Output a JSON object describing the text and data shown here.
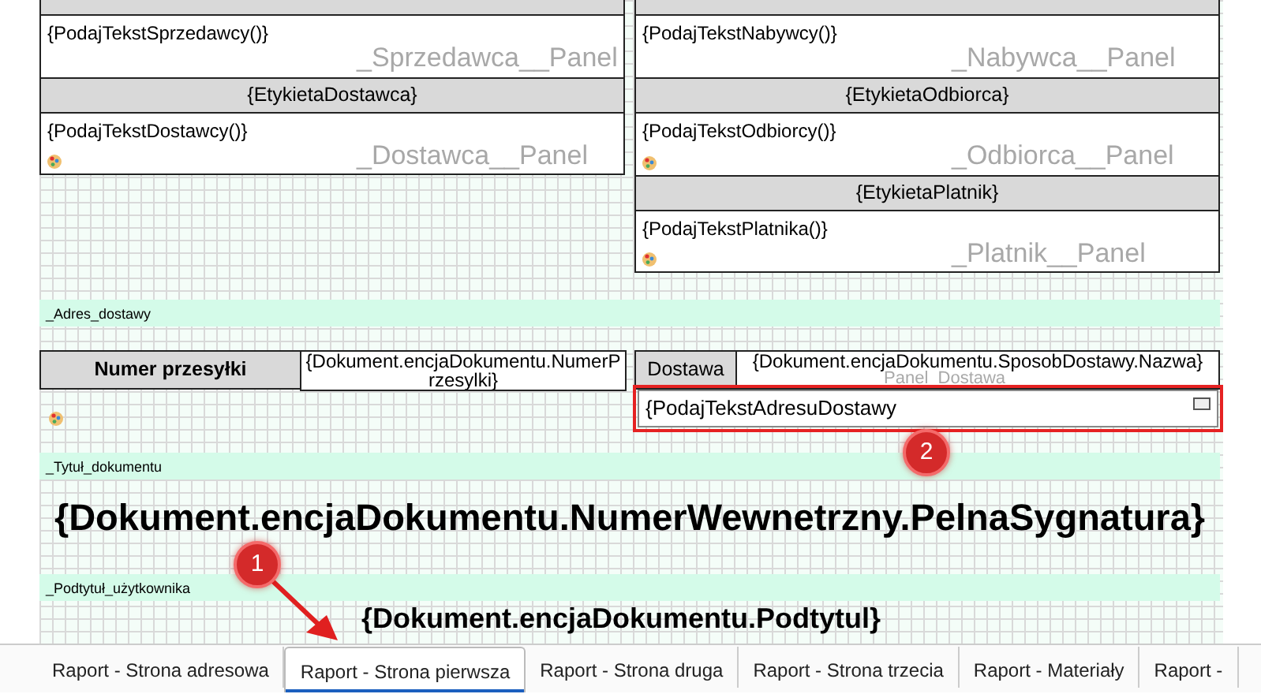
{
  "left_column": [
    {
      "kind": "header"
    },
    {
      "kind": "body",
      "text": "{PodajTekstSprzedawcy()}",
      "ghost": "_Sprzedawca__Panel",
      "has_icon": false
    },
    {
      "kind": "header",
      "text": "{EtykietaDostawca}"
    },
    {
      "kind": "body",
      "text": "{PodajTekstDostawcy()}",
      "ghost": "_Dostawca__Panel",
      "has_icon": true
    }
  ],
  "right_column": [
    {
      "kind": "header"
    },
    {
      "kind": "body",
      "text": "{PodajTekstNabywcy()}",
      "ghost": "_Nabywca__Panel",
      "has_icon": false
    },
    {
      "kind": "header",
      "text": "{EtykietaOdbiorca}"
    },
    {
      "kind": "body",
      "text": "{PodajTekstOdbiorcy()}",
      "ghost": "_Odbiorca__Panel",
      "has_icon": true
    },
    {
      "kind": "header",
      "text": "{EtykietaPlatnik}"
    },
    {
      "kind": "body",
      "text": "{PodajTekstPlatnika()}",
      "ghost": "_Platnik__Panel",
      "has_icon": true
    }
  ],
  "bands": [
    {
      "label": "_Adres_dostawy"
    },
    {
      "label": "_Tytuł_dokumentu"
    },
    {
      "label": "_Podtytuł_użytkownika"
    }
  ],
  "shipment": {
    "label": "Numer przesyłki",
    "value": "{Dokument.encjaDokumentu.NumerPrzesylki}"
  },
  "delivery": {
    "label": "Dostawa",
    "value": "{Dokument.encjaDokumentu.SposobDostawy.Nazwa}",
    "ghost": "Panel_Dostawa"
  },
  "address": {
    "text": "{PodajTekstAdresuDostawy",
    "selected": true
  },
  "title": "{Dokument.encjaDokumentu.NumerWewnetrzny.PelnaSygnatura}",
  "subtitle": "{Dokument.encjaDokumentu.Podtytul}",
  "callouts": [
    {
      "number": "1"
    },
    {
      "number": "2"
    }
  ],
  "tabs": [
    {
      "label": "Raport - Strona adresowa",
      "selected": false
    },
    {
      "label": "Raport - Strona pierwsza",
      "selected": true
    },
    {
      "label": "Raport - Strona druga",
      "selected": false
    },
    {
      "label": "Raport - Strona trzecia",
      "selected": false
    },
    {
      "label": "Raport - Materiały",
      "selected": false
    },
    {
      "label": "Raport -",
      "selected": false
    }
  ]
}
